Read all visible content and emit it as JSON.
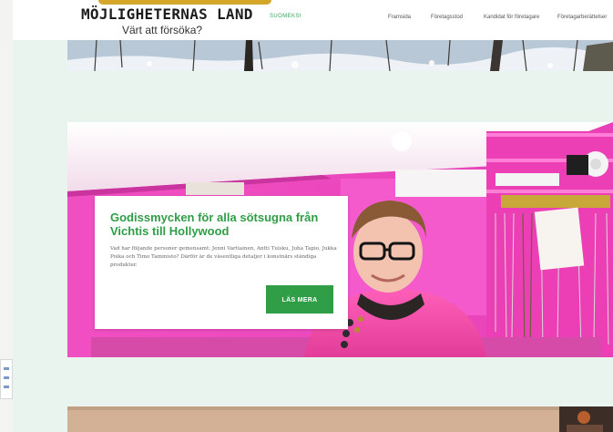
{
  "brand": {
    "title": "MÖJLIGHETERNAS LAND",
    "tagline": "Värt att försöka?"
  },
  "language": {
    "label": "SUOMEKSI"
  },
  "nav": {
    "items": [
      {
        "label": "Framsida"
      },
      {
        "label": "Företagsstod"
      },
      {
        "label": "Kandidat för företagare"
      },
      {
        "label": "Företagarberättelser"
      }
    ]
  },
  "featured": {
    "heading": "Godissmycken för alla sötsugna från Vichtis till Hollywood",
    "excerpt": "Vad har följande personer gemensamt: Jenni Vartiainen, Antti Tuisku, Juha Tapio, Jukka Poika och Timo Tammisto? Därför är de väsentliga detaljer i konstnärs ständiga produkter.",
    "button_label": "LÄS MERA"
  },
  "colors": {
    "accent_green": "#2f9e46",
    "background": "#e9f4ee",
    "logo_gold": "#d4a72a",
    "photo_pink": "#e24ab8"
  },
  "icons": {
    "snow_strip": "winter-forest-image",
    "portrait": "shop-portrait-image"
  }
}
